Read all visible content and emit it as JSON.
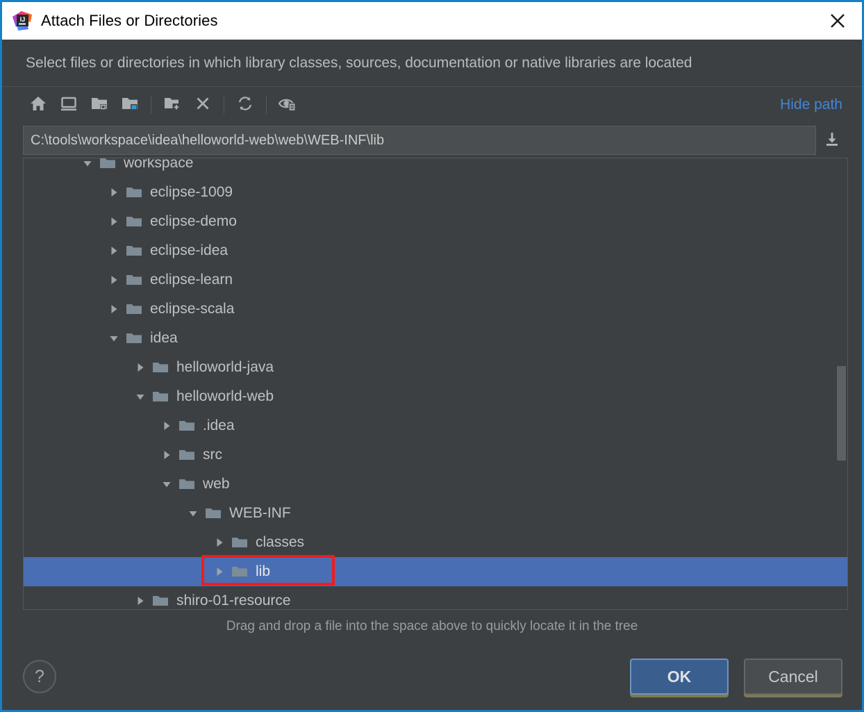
{
  "window": {
    "title": "Attach Files or Directories",
    "logo_icon": "intellij-idea-logo",
    "close_icon": "close-icon",
    "accent_border_color": "#1681c9",
    "background_color": "#3c4042"
  },
  "subtitle": "Select files or directories in which library classes, sources, documentation or native libraries are located",
  "toolbar": {
    "buttons": [
      {
        "name": "home-button",
        "icon": "home-icon",
        "tooltip": "Home"
      },
      {
        "name": "desktop-button",
        "icon": "desktop-icon",
        "tooltip": "Desktop"
      },
      {
        "name": "collapse-all-button",
        "icon": "folder-collapse-icon",
        "tooltip": "Collapse All"
      },
      {
        "name": "project-folder-button",
        "icon": "folder-selected-icon",
        "tooltip": "Project Directory"
      },
      {
        "name": "new-folder-button",
        "icon": "new-folder-icon",
        "tooltip": "New Folder"
      },
      {
        "name": "delete-button",
        "icon": "close-x-icon",
        "tooltip": "Delete"
      },
      {
        "name": "refresh-button",
        "icon": "refresh-icon",
        "tooltip": "Refresh"
      },
      {
        "name": "show-hidden-button",
        "icon": "show-hidden-files-icon",
        "tooltip": "Show Hidden Files and Directories"
      }
    ],
    "hide_path_label": "Hide path",
    "hide_path_color": "#4286d6"
  },
  "path": {
    "value": "C:\\tools\\workspace\\idea\\helloworld-web\\web\\WEB-INF\\lib",
    "placeholder": "",
    "download_icon": "insert-path-icon"
  },
  "tree": {
    "rows": [
      {
        "label": "workspace",
        "depth": 1,
        "expander": "down",
        "icon": "folder-icon",
        "selected": false,
        "clipped": true
      },
      {
        "label": "eclipse-1009",
        "depth": 2,
        "expander": "right",
        "icon": "folder-icon",
        "selected": false
      },
      {
        "label": "eclipse-demo",
        "depth": 2,
        "expander": "right",
        "icon": "folder-icon",
        "selected": false
      },
      {
        "label": "eclipse-idea",
        "depth": 2,
        "expander": "right",
        "icon": "folder-icon",
        "selected": false
      },
      {
        "label": "eclipse-learn",
        "depth": 2,
        "expander": "right",
        "icon": "folder-icon",
        "selected": false
      },
      {
        "label": "eclipse-scala",
        "depth": 2,
        "expander": "right",
        "icon": "folder-icon",
        "selected": false
      },
      {
        "label": "idea",
        "depth": 2,
        "expander": "down",
        "icon": "folder-icon",
        "selected": false
      },
      {
        "label": "helloworld-java",
        "depth": 3,
        "expander": "right",
        "icon": "folder-icon",
        "selected": false
      },
      {
        "label": "helloworld-web",
        "depth": 3,
        "expander": "down",
        "icon": "folder-icon",
        "selected": false
      },
      {
        "label": ".idea",
        "depth": 4,
        "expander": "right",
        "icon": "folder-icon",
        "selected": false
      },
      {
        "label": "src",
        "depth": 4,
        "expander": "right",
        "icon": "folder-icon",
        "selected": false
      },
      {
        "label": "web",
        "depth": 4,
        "expander": "down",
        "icon": "folder-icon",
        "selected": false
      },
      {
        "label": "WEB-INF",
        "depth": 5,
        "expander": "down",
        "icon": "folder-icon",
        "selected": false
      },
      {
        "label": "classes",
        "depth": 6,
        "expander": "right",
        "icon": "folder-icon",
        "selected": false
      },
      {
        "label": "lib",
        "depth": 6,
        "expander": "right",
        "icon": "folder-icon",
        "selected": true,
        "annotated": true
      },
      {
        "label": "shiro-01-resource",
        "depth": 3,
        "expander": "right",
        "icon": "folder-icon",
        "selected": false
      }
    ],
    "selection_color": "#4a6eb4",
    "annotation_color": "#f01c1c",
    "scrollbar": {
      "thumb_top_pct": 46,
      "thumb_height_pct": 21
    }
  },
  "hint": "Drag and drop a file into the space above to quickly locate it in the tree",
  "footer": {
    "help_label": "?",
    "help_icon": "question-mark-icon",
    "ok_label": "OK",
    "cancel_label": "Cancel"
  }
}
